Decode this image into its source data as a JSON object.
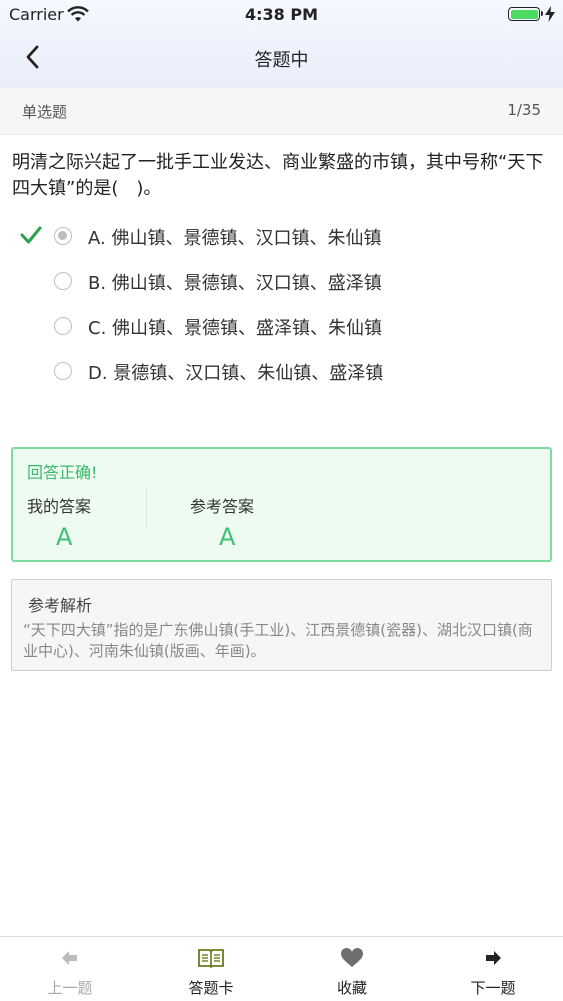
{
  "status_bar": {
    "carrier": "Carrier",
    "time": "4:38 PM",
    "battery_color": "#4cd964"
  },
  "nav": {
    "title": "答题中",
    "back_icon": "chevron-left-icon"
  },
  "question_header": {
    "type": "单选题",
    "progress": "1/35"
  },
  "question": {
    "text": "明清之际兴起了一批手工业发达、商业繁盛的市镇，其中号称“天下四大镇”的是(　)。"
  },
  "options": [
    {
      "label": "A. 佛山镇、景德镇、汉口镇、朱仙镇",
      "selected": true,
      "correct": true
    },
    {
      "label": "B. 佛山镇、景德镇、汉口镇、盛泽镇",
      "selected": false,
      "correct": false
    },
    {
      "label": "C. 佛山镇、景德镇、盛泽镇、朱仙镇",
      "selected": false,
      "correct": false
    },
    {
      "label": "D. 景德镇、汉口镇、朱仙镇、盛泽镇",
      "selected": false,
      "correct": false
    }
  ],
  "result": {
    "title": "回答正确!",
    "my_answer_label": "我的答案",
    "my_answer": "A",
    "reference_label": "参考答案",
    "reference_answer": "A",
    "accent_color": "#3ec27a"
  },
  "analysis": {
    "title": "参考解析",
    "text": "“天下四大镇”指的是广东佛山镇(手工业)、江西景德镇(瓷器)、湖北汉口镇(商业中心)、河南朱仙镇(版画、年画)。"
  },
  "tabbar": {
    "prev": {
      "label": "上一题",
      "icon": "arrow-left-icon",
      "disabled": true
    },
    "card": {
      "label": "答题卡",
      "icon": "book-icon"
    },
    "favorite": {
      "label": "收藏",
      "icon": "heart-icon"
    },
    "next": {
      "label": "下一题",
      "icon": "arrow-right-icon"
    }
  }
}
